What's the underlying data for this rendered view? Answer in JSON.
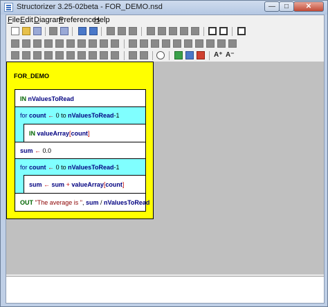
{
  "window": {
    "title": "Structorizer 3.25-02beta - FOR_DEMO.nsd",
    "min_glyph": "—",
    "max_glyph": "□",
    "close_glyph": "✕"
  },
  "menu": [
    {
      "accel": "F",
      "rest": "ile"
    },
    {
      "accel": "E",
      "rest": "dit"
    },
    {
      "accel": "D",
      "rest": "iagram"
    },
    {
      "accel": "P",
      "rest": "references"
    },
    {
      "accel": "H",
      "rest": "elp"
    }
  ],
  "toolbar": {
    "font_up": "A⁺",
    "font_down": "A⁻"
  },
  "diagram": {
    "name": "FOR_DEMO",
    "elements": [
      {
        "kind": "input",
        "keyword": "IN",
        "var": "nValuesToRead"
      },
      {
        "kind": "for",
        "keyword": "for",
        "var": "count",
        "arrow": "←",
        "from": "0 to",
        "limit": "nValuesToRead",
        "suffix": "-1"
      },
      {
        "kind": "input",
        "keyword": "IN",
        "var": "valueArray",
        "open": "[",
        "index": "count",
        "close": "]"
      },
      {
        "kind": "assign",
        "var": "sum",
        "arrow": "←",
        "value": "0.0"
      },
      {
        "kind": "for",
        "keyword": "for",
        "var": "count",
        "arrow": "←",
        "from": "0 to",
        "limit": "nValuesToRead",
        "suffix": "-1"
      },
      {
        "kind": "assign",
        "var": "sum",
        "arrow": "←",
        "expr1": "sum",
        "plus": "+",
        "expr2": "valueArray",
        "open": "[",
        "index": "count",
        "close": "]"
      },
      {
        "kind": "output",
        "keyword": "OUT",
        "string": "\"The average is \"",
        "comma": ",",
        "expr1": "sum",
        "slash": "/",
        "expr2": "nValuesToRead"
      }
    ]
  },
  "colors": {
    "diagram_bg": "#ffff00",
    "loop_bg": "#80ffff",
    "block_bg": "#ffffff",
    "workspace_bg": "#c0c0c0"
  }
}
